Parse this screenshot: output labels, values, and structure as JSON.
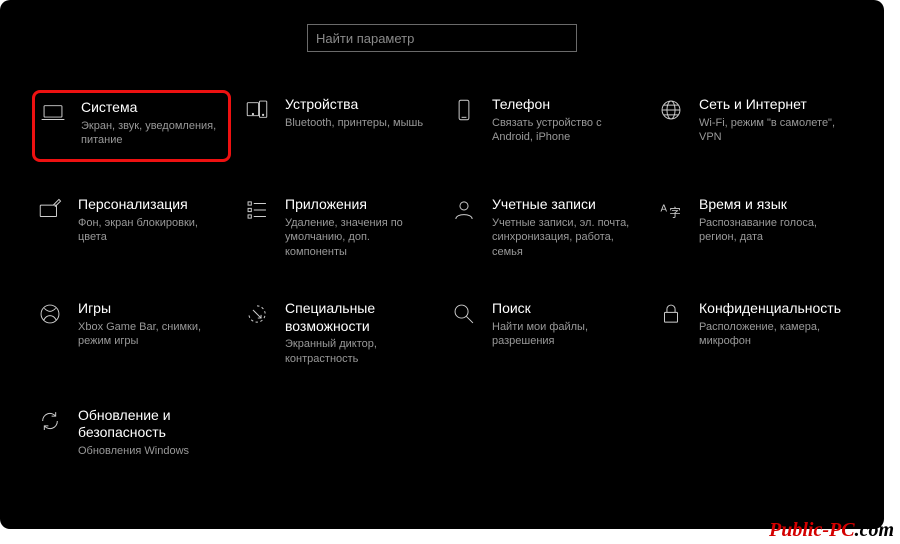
{
  "search": {
    "placeholder": "Найти параметр"
  },
  "tiles": [
    {
      "id": "system",
      "title": "Система",
      "desc": "Экран, звук, уведомления, питание",
      "highlight": true
    },
    {
      "id": "devices",
      "title": "Устройства",
      "desc": "Bluetooth, принтеры, мышь"
    },
    {
      "id": "phone",
      "title": "Телефон",
      "desc": "Связать устройство с Android, iPhone"
    },
    {
      "id": "network",
      "title": "Сеть и Интернет",
      "desc": "Wi-Fi, режим \"в самолете\", VPN"
    },
    {
      "id": "personalization",
      "title": "Персонализация",
      "desc": "Фон, экран блокировки, цвета"
    },
    {
      "id": "apps",
      "title": "Приложения",
      "desc": "Удаление, значения по умолчанию, доп. компоненты"
    },
    {
      "id": "accounts",
      "title": "Учетные записи",
      "desc": "Учетные записи, эл. почта, синхронизация, работа, семья"
    },
    {
      "id": "time-language",
      "title": "Время и язык",
      "desc": "Распознавание голоса, регион, дата"
    },
    {
      "id": "gaming",
      "title": "Игры",
      "desc": "Xbox Game Bar, снимки, режим игры"
    },
    {
      "id": "ease-of-access",
      "title": "Специальные возможности",
      "desc": "Экранный диктор, контрастность"
    },
    {
      "id": "search-cat",
      "title": "Поиск",
      "desc": "Найти мои файлы, разрешения"
    },
    {
      "id": "privacy",
      "title": "Конфиденциальность",
      "desc": "Расположение, камера, микрофон"
    },
    {
      "id": "update",
      "title": "Обновление и безопасность",
      "desc": "Обновления Windows"
    }
  ],
  "watermark": {
    "part1": "Public-PC",
    "part2": ".com"
  }
}
